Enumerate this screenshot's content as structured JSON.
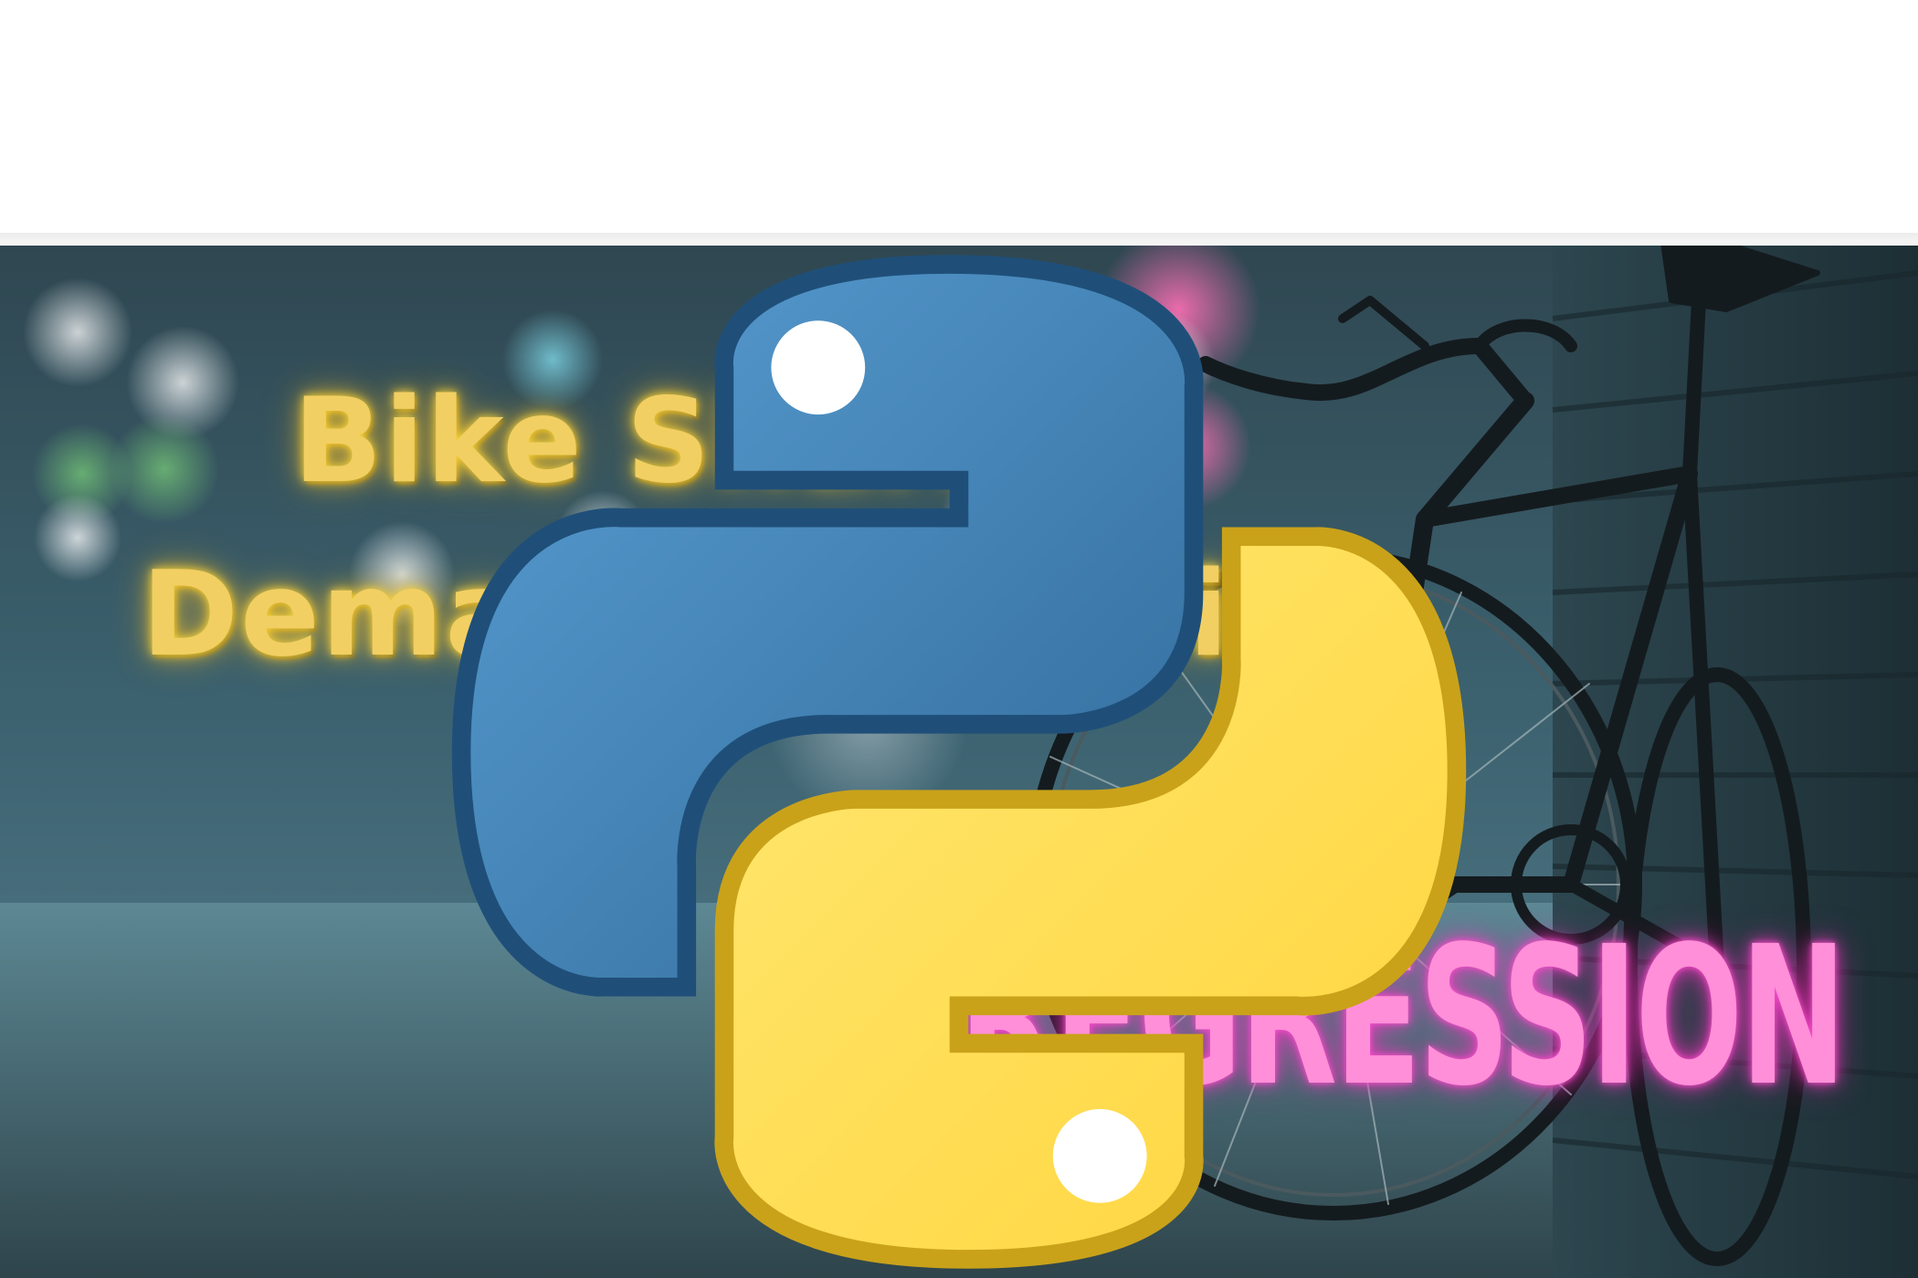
{
  "banner": {
    "title_line_1": "Bike Sharing",
    "title_line_2": "Demand Analysis",
    "subtitle": "REGRESSION",
    "logo_icon": "python-logo-icon",
    "image_subject": "bicycle-photo"
  },
  "colors": {
    "title": "#f2cf63",
    "subtitle": "#ff8fd8",
    "python_blue": "#3d73a8",
    "python_yellow": "#ffd43b"
  }
}
